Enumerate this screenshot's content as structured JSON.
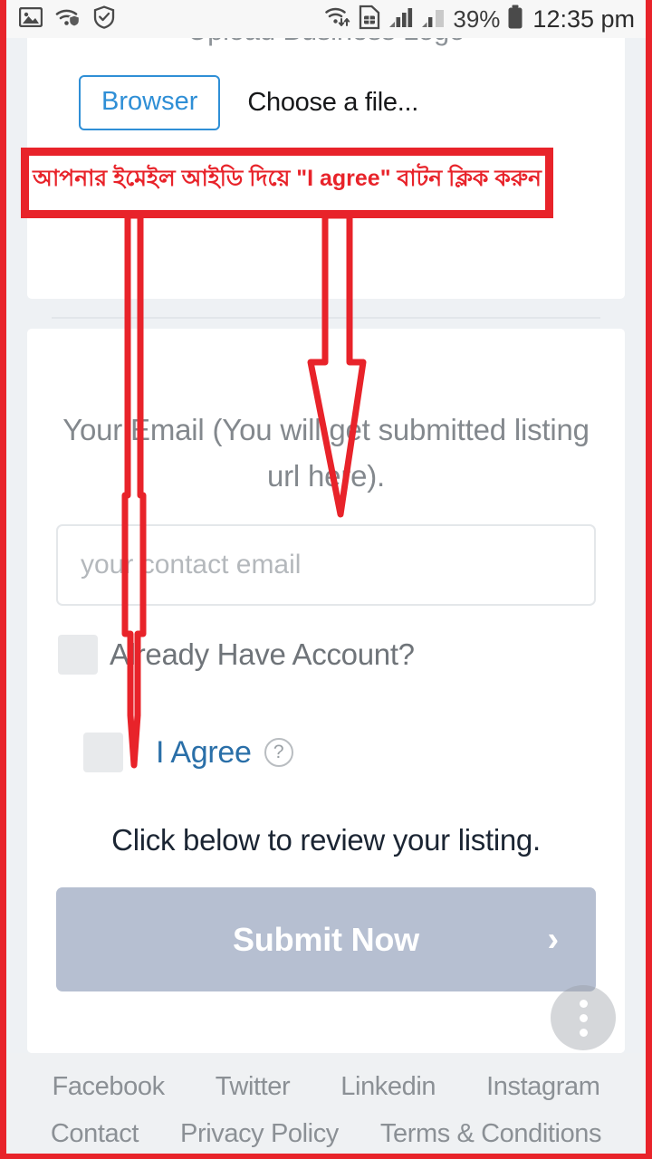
{
  "statusbar": {
    "icons_left": [
      "image-icon",
      "wifi-protected-icon",
      "shield-check-icon"
    ],
    "icons_right": [
      "wifi-transfer-icon",
      "sim-card-icon",
      "signal-bars-icon",
      "signal-bars-2-icon",
      "battery-icon"
    ],
    "battery_percent": "39%",
    "time": "12:35 pm"
  },
  "upload_card": {
    "title": "Upload Business Logo",
    "browse_button": "Browser",
    "file_status": "Choose a file..."
  },
  "annotation": {
    "bengali_note": "আপনার ইমেইল আইডি দিয়ে \"I agree\" বাটন ক্লিক করুন",
    "box_color": "#e8232a",
    "arrow_color": "#e8232a"
  },
  "form_card": {
    "email_label": "Your Email (You will get submitted listing url here).",
    "email_value": "",
    "email_placeholder": "your contact email",
    "already_account_label": "Already Have Account?",
    "already_account_checked": false,
    "agree_label": "I Agree",
    "agree_checked": false,
    "help_icon_glyph": "?",
    "review_text": "Click below to review your listing.",
    "submit_label": "Submit Now",
    "submit_chevron": "›",
    "submit_color": "#b6bfd1"
  },
  "fab": {
    "name": "more-options-fab"
  },
  "footer": {
    "social": [
      "Facebook",
      "Twitter",
      "Linkedin",
      "Instagram"
    ],
    "pages": [
      "Contact",
      "Privacy Policy",
      "Terms & Conditions"
    ]
  }
}
